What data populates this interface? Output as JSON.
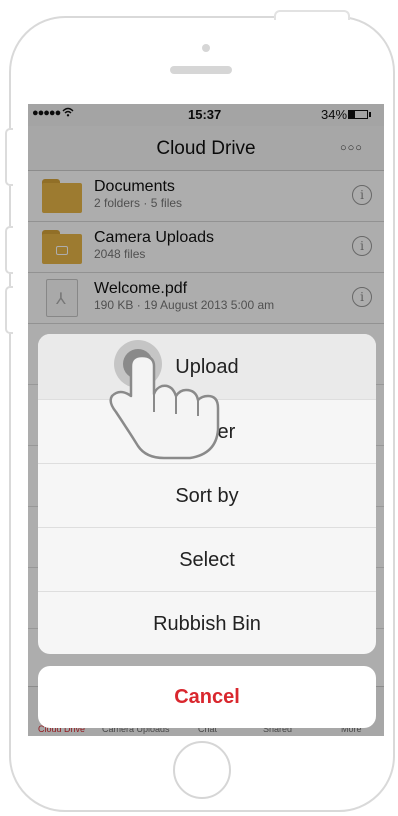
{
  "status_bar": {
    "signal": "●●●●● ",
    "time": "15:37",
    "battery": "34%"
  },
  "nav": {
    "title": "Cloud Drive"
  },
  "files": [
    {
      "name": "Documents",
      "meta": "2 folders · 5 files",
      "icon": "folder-icon"
    },
    {
      "name": "Camera Uploads",
      "meta": "2048 files",
      "icon": "camera-folder-icon"
    },
    {
      "name": "Welcome.pdf",
      "meta": "190 KB · 19 August 2013  5:00 am",
      "icon": "pdf-icon"
    }
  ],
  "action_sheet": {
    "items": [
      "Upload",
      "Folder",
      "Sort by",
      "Select",
      "Rubbish Bin"
    ],
    "cancel": "Cancel"
  },
  "tab_bar": {
    "items": [
      "Cloud Drive",
      "Camera Uploads",
      "Chat",
      "Shared",
      "More"
    ]
  },
  "colors": {
    "accent": "#d9272e",
    "folder": "#e8b547"
  }
}
